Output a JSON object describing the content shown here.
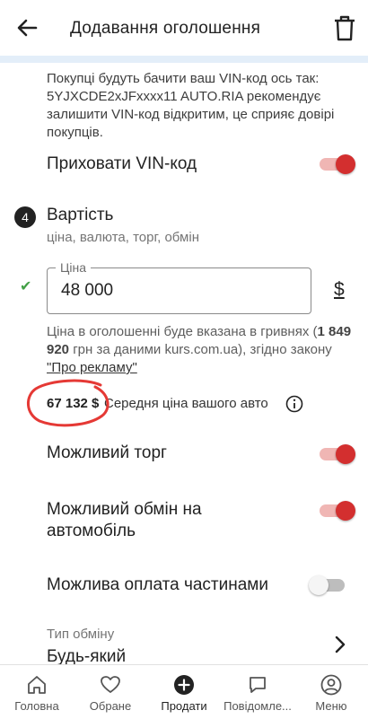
{
  "header": {
    "title": "Додавання оголошення",
    "back_icon": "arrow-left-icon",
    "delete_icon": "trash-icon"
  },
  "vin": {
    "info_text": "Покупці будуть бачити ваш VIN-код ось так: 5YJXCDE2xJFxxxx11 AUTO.RIA рекомендує залишити VIN-код відкритим, це сприяє довірі покупців.",
    "hide_label": "Приховати VIN-код",
    "hide_enabled": true
  },
  "price_section": {
    "step_number": "4",
    "title": "Вартість",
    "subtitle": "ціна, валюта, торг, обмін",
    "field_label": "Ціна",
    "field_value": "48 000",
    "currency": "$",
    "note_prefix": "Ціна в оголошенні буде вказана в гривнях (",
    "note_uah": "1 849 920",
    "note_middle": " грн за даними kurs.com.ua), згідно закону ",
    "note_link": "\"Про рекламу\"",
    "avg_price": "67 132 $",
    "avg_label": "Середня ціна вашого авто"
  },
  "options": {
    "bargain_label": "Можливий торг",
    "bargain_enabled": true,
    "exchange_label": "Можливий обмін на автомобіль",
    "exchange_enabled": true,
    "installments_label": "Можлива оплата частинами",
    "installments_enabled": false,
    "exchange_type_caption": "Тип обміну",
    "exchange_type_value": "Будь-який"
  },
  "bottom_nav": {
    "items": [
      {
        "label": "Головна",
        "icon": "home-icon"
      },
      {
        "label": "Обране",
        "icon": "heart-icon"
      },
      {
        "label": "Продати",
        "icon": "plus-circle-icon"
      },
      {
        "label": "Повідомле...",
        "icon": "chat-icon"
      },
      {
        "label": "Меню",
        "icon": "user-icon"
      }
    ]
  },
  "colors": {
    "accent_red": "#d32f2f",
    "toggle_track_on": "#f0b6b4",
    "check_green": "#43a047",
    "strip_blue": "#e3eef9"
  }
}
